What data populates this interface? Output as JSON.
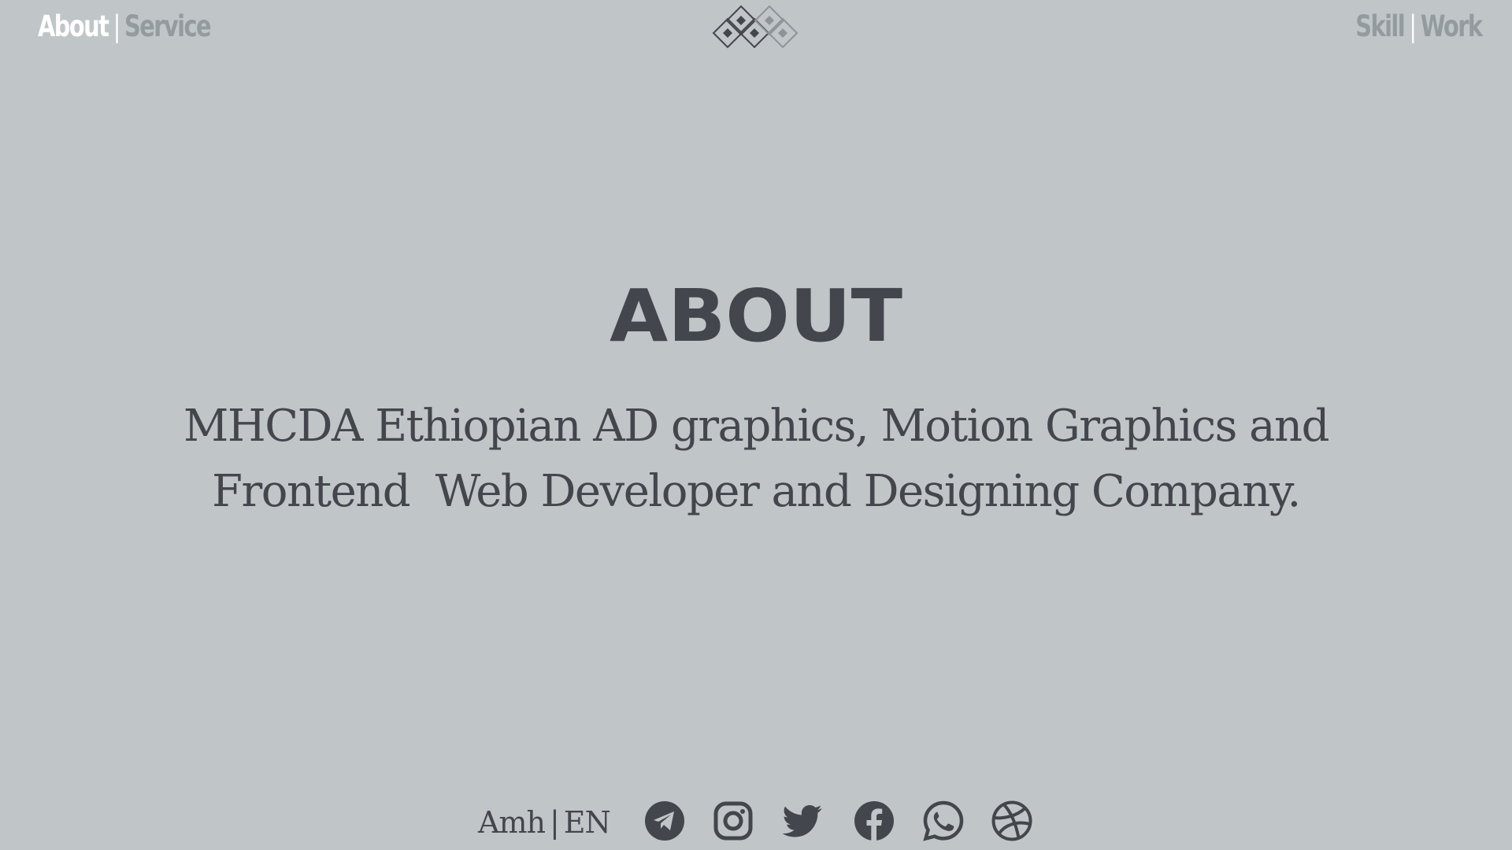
{
  "nav": {
    "left": [
      {
        "label": "About",
        "active": true
      },
      {
        "label": "Service",
        "active": false
      }
    ],
    "right": [
      {
        "label": "Skill",
        "active": false
      },
      {
        "label": "Work",
        "active": false
      }
    ],
    "separator": "|"
  },
  "logo": {
    "icon": "diamond-pattern-logo"
  },
  "hero": {
    "title": "ABOUT",
    "tagline_line1": "MHCDA Ethiopian AD graphics, Motion Graphics and",
    "tagline_line2": "Frontend  Web Developer and Designing Company."
  },
  "footer": {
    "lang_amh": "Amh",
    "lang_sep": "|",
    "lang_en": "EN",
    "social": [
      {
        "icon": "telegram-icon"
      },
      {
        "icon": "instagram-icon"
      },
      {
        "icon": "twitter-icon"
      },
      {
        "icon": "facebook-icon"
      },
      {
        "icon": "whatsapp-icon"
      },
      {
        "icon": "dribbble-icon"
      }
    ]
  },
  "colors": {
    "background": "#c0c5c8",
    "nav_active": "#ffffff",
    "nav_inactive": "#949b9e",
    "text_dark": "#43464c"
  }
}
